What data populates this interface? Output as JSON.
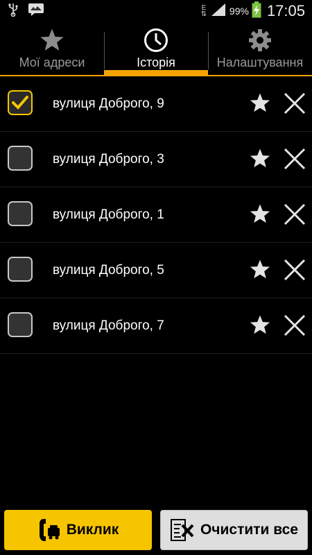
{
  "status_bar": {
    "network_letter": "E",
    "battery": "99%",
    "time": "17:05"
  },
  "tabs": [
    {
      "label": "Мої адреси",
      "icon": "star-icon",
      "active": false
    },
    {
      "label": "Історія",
      "icon": "clock-icon",
      "active": true
    },
    {
      "label": "Налаштування",
      "icon": "gear-icon",
      "active": false
    }
  ],
  "history": [
    {
      "address": "вулиця Доброго, 9",
      "checked": true
    },
    {
      "address": "вулиця Доброго, 3",
      "checked": false
    },
    {
      "address": "вулиця Доброго, 1",
      "checked": false
    },
    {
      "address": "вулиця Доброго, 5",
      "checked": false
    },
    {
      "address": "вулиця Доброго, 7",
      "checked": false
    }
  ],
  "buttons": {
    "call_label": "Виклик",
    "clear_label": "Очистити все"
  },
  "colors": {
    "accent": "#f6a400",
    "call_button": "#f6c500",
    "clear_button": "#dedede"
  }
}
